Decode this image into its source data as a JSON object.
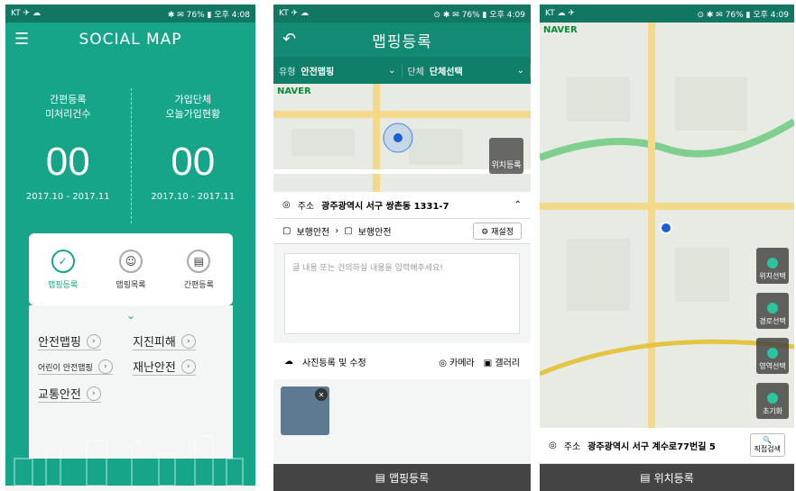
{
  "status": {
    "p1_left": "KT ✈ ☁",
    "p1_right": "✱ ✉ 76% ▮ 오후 4:08",
    "p2_left": "KT ✈ ☁",
    "p2_right": "⊙ ✱ ✉ 76% ▮ 오후 4:09",
    "p3_left": "KT ☁ ✈",
    "p3_right": "⊙ ✱ ✉ 76% ▮ 오후 4:09"
  },
  "screen1": {
    "title": "SOCIAL MAP",
    "left_stat": {
      "line1": "간편등록",
      "line2": "미처리건수",
      "value": "00",
      "range": "2017.10 - 2017.11"
    },
    "right_stat": {
      "line1": "가입단체",
      "line2": "오늘가입현황",
      "value": "00",
      "range": "2017.10 - 2017.11"
    },
    "menu": [
      {
        "label": "맵핑등록",
        "icon": "pin-check-icon"
      },
      {
        "label": "맵핑목록",
        "icon": "pin-user-icon"
      },
      {
        "label": "간편등록",
        "icon": "pin-doc-icon"
      }
    ],
    "categories": {
      "safety": "안전맵핑",
      "earthquake": "지진피해",
      "child": "어린이 안전맵핑",
      "disaster": "재난안전",
      "traffic": "교통안전"
    }
  },
  "screen2": {
    "title": "맵핑등록",
    "type_label": "유형",
    "type_value": "안전맵핑",
    "group_label": "단체",
    "group_value": "단체선택",
    "map_brand": "NAVER",
    "locate_button": "위치등록",
    "address_label": "주소",
    "address_value": "광주광역시 서구 쌍촌동 1331-7",
    "step_from": "보행안전",
    "step_to": "보행안전",
    "reset_button": "재설정",
    "textarea_placeholder": "글 내용 또는 건의하실 내용을 입력해주세요!",
    "photo_title": "사진등록 및 수정",
    "camera": "카메라",
    "gallery": "갤러리",
    "bottom_button": "맵핑등록"
  },
  "screen3": {
    "map_brand": "NAVER",
    "side_buttons": [
      "위치선택",
      "경로선택",
      "영역선택",
      "초기화"
    ],
    "address_label": "주소",
    "address_value": "광주광역시 서구 계수로77번길 5",
    "search_button": "직접검색",
    "bottom_button": "위치등록"
  }
}
